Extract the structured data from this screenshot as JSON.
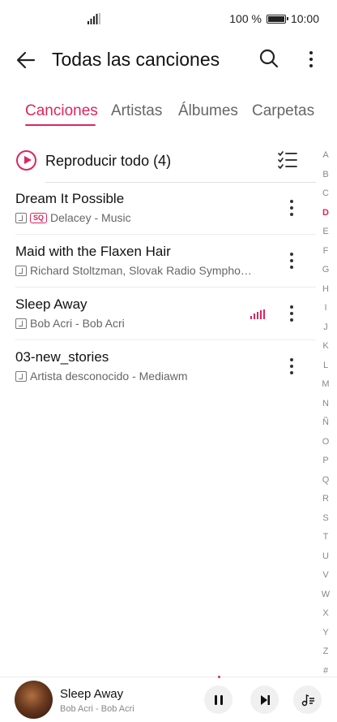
{
  "status_bar": {
    "battery_text": "100 %",
    "time": "10:00"
  },
  "app_bar": {
    "title": "Todas las canciones",
    "back_icon": "back-arrow-icon",
    "search_icon": "search-icon",
    "more_icon": "more-vertical-icon"
  },
  "tabs": [
    {
      "label": "Canciones",
      "active": true
    },
    {
      "label": "Artistas",
      "active": false
    },
    {
      "label": "Álbumes",
      "active": false
    },
    {
      "label": "Carpetas",
      "active": false
    }
  ],
  "play_all": {
    "label": "Reproducir todo (4)",
    "icon": "play-circle-icon",
    "multiselect_icon": "checklist-icon"
  },
  "songs": [
    {
      "title": "Dream It Possible",
      "subtitle": "Delacey - Music",
      "badge": "SQ",
      "playing": false
    },
    {
      "title": "Maid with the Flaxen Hair",
      "subtitle": "Richard Stoltzman, Slovak Radio Sympho…",
      "playing": false
    },
    {
      "title": "Sleep Away",
      "subtitle": "Bob Acri - Bob Acri",
      "playing": true
    },
    {
      "title": "03-new_stories",
      "subtitle": "Artista desconocido - Mediawm",
      "playing": false
    }
  ],
  "alphabet": [
    "A",
    "B",
    "C",
    "D",
    "E",
    "F",
    "G",
    "H",
    "I",
    "J",
    "K",
    "L",
    "M",
    "N",
    "Ñ",
    "O",
    "P",
    "Q",
    "R",
    "S",
    "T",
    "U",
    "V",
    "W",
    "X",
    "Y",
    "Z",
    "#"
  ],
  "alphabet_active": "D",
  "now_playing": {
    "title": "Sleep Away",
    "subtitle": "Bob Acri - Bob Acri",
    "pause_icon": "pause-icon",
    "next_icon": "skip-next-icon",
    "queue_icon": "playlist-icon"
  },
  "colors": {
    "accent": "#e0245e",
    "text": "#111111",
    "secondary": "#666666"
  }
}
